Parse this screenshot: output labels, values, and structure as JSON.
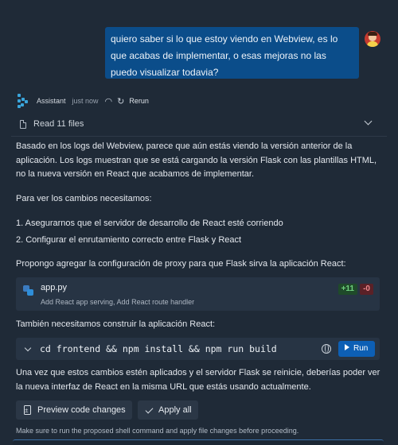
{
  "user_message": {
    "text": "quiero saber si lo que estoy viendo en Webview, es lo que acabas de implementar, o esas mejoras no las puedo visualizar todavia?"
  },
  "assistant": {
    "name": "Assistant",
    "time": "just now",
    "rerun_label": "Rerun"
  },
  "read_files": {
    "label": "Read 11 files"
  },
  "message": {
    "p1": "Basado en los logs del Webview, parece que aún estás viendo la versión anterior de la aplicación. Los logs muestran que se está cargando la versión Flask con las plantillas HTML, no la nueva versión en React que acabamos de implementar.",
    "p2": "Para ver los cambios necesitamos:",
    "list1": "1. Asegurarnos que el servidor de desarrollo de React esté corriendo",
    "list2": "2. Configurar el enrutamiento correcto entre Flask y React",
    "p3": "Propongo agregar la configuración de proxy para que Flask sirva la aplicación React:",
    "p4": "También necesitamos construir la aplicación React:",
    "p5": "Una vez que estos cambios estén aplicados y el servidor Flask se reinicie, deberías poder ver la nueva interfaz de React en la misma URL que estás usando actualmente."
  },
  "file_change": {
    "filename": "app.py",
    "description": "Add React app serving, Add React route handler",
    "additions": "+11",
    "deletions": "-0"
  },
  "command": {
    "text": "cd frontend && npm install && npm run build",
    "run_label": "Run"
  },
  "actions": {
    "preview_label": "Preview code changes",
    "apply_label": "Apply all"
  },
  "footnote": "Make sure to run the proposed shell command and apply file changes before proceeding.",
  "colors": {
    "background": "#1f2a37",
    "user_bubble": "#0b4d8a",
    "card": "#273444",
    "run_button": "#0d5fb5",
    "additions": "#6fd17e",
    "deletions": "#ee8a8e"
  }
}
